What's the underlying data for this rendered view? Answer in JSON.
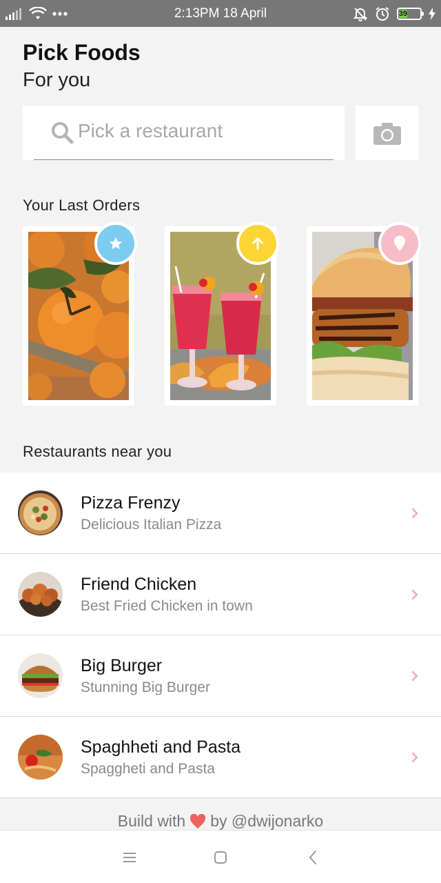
{
  "status_bar": {
    "time_date": "2:13PM 18 April",
    "battery_percent": 39,
    "icons": [
      "signal-icon",
      "wifi-icon",
      "more-dots-icon",
      "silent-bell-icon",
      "alarm-icon",
      "battery-icon",
      "charging-icon"
    ]
  },
  "header": {
    "title": "Pick Foods",
    "subtitle": "For you"
  },
  "search": {
    "placeholder": "Pick a restaurant",
    "icon": "search-icon",
    "camera_icon": "camera-icon"
  },
  "last_orders": {
    "label": "Your Last Orders",
    "items": [
      {
        "image": "oranges-photo",
        "badge_icon": "star-icon",
        "badge_color": "#7cccef"
      },
      {
        "image": "red-drinks-photo",
        "badge_icon": "arrow-up-icon",
        "badge_color": "#fcd535"
      },
      {
        "image": "chicken-burger-photo",
        "badge_icon": "location-pin-icon",
        "badge_color": "#f8bcc9"
      }
    ]
  },
  "restaurants": {
    "label": "Restaurants near you",
    "items": [
      {
        "name": "Pizza Frenzy",
        "description": "Delicious Italian Pizza",
        "image": "pizza-photo"
      },
      {
        "name": "Friend Chicken",
        "description": "Best Fried Chicken in town",
        "image": "fried-chicken-photo"
      },
      {
        "name": "Big Burger",
        "description": "Stunning Big Burger",
        "image": "burger-photo"
      },
      {
        "name": "Spaghheti and Pasta",
        "description": "Spaggheti and Pasta",
        "image": "pasta-photo"
      }
    ],
    "chevron_color": "#f4a9b9"
  },
  "footer": {
    "prefix": "Build with",
    "suffix": "by @dwijonarko",
    "heart_color": "#f0605f"
  },
  "nav": {
    "icons": [
      "menu-icon",
      "home-square-icon",
      "back-icon"
    ]
  }
}
